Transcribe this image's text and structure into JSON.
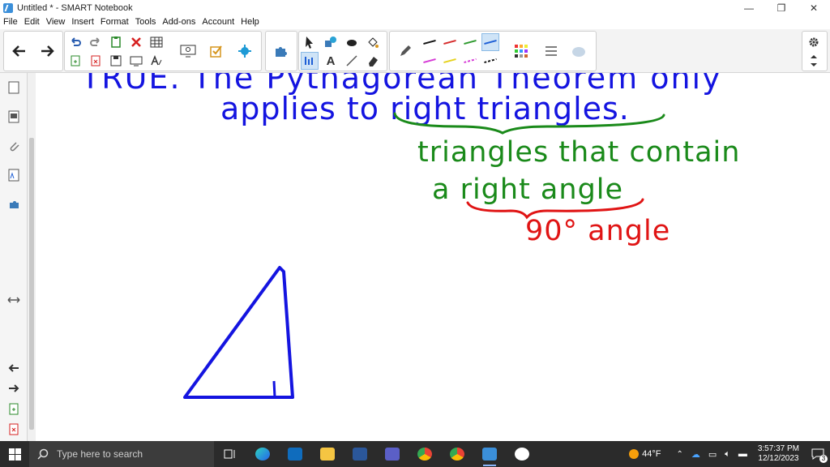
{
  "window": {
    "title": "Untitled * - SMART Notebook",
    "controls": {
      "minimize": "—",
      "restore": "❐",
      "close": "✕"
    }
  },
  "menu": [
    "File",
    "Edit",
    "View",
    "Insert",
    "Format",
    "Tools",
    "Add-ons",
    "Account",
    "Help"
  ],
  "toolbar": {
    "icons": {
      "back": "arrow-left-icon",
      "forward": "arrow-right-icon",
      "undo": "undo-icon",
      "redo": "redo-icon",
      "paste": "paste-icon",
      "delete": "delete-icon",
      "table": "table-icon",
      "screen": "screen-shade-icon",
      "check": "check-icon",
      "addon": "addon-icon",
      "select": "select-icon",
      "shapes": "shapes-icon",
      "eraser": "eraser-icon",
      "fill": "fill-icon",
      "text": "text-icon",
      "line": "line-icon",
      "pen": "pen-icon",
      "settings": "gear-icon",
      "properties": "properties-icon"
    },
    "pen_colors": [
      "#111111",
      "#d62b2b",
      "#2e9a2e",
      "#1e5fd6",
      "#d63ad6",
      "#e6d21e",
      "#111111"
    ],
    "accent": "#cfe4f7"
  },
  "canvas": {
    "ink_blue": "#1414e0",
    "ink_green": "#1a8a1a",
    "ink_red": "#e01414",
    "line1": "TRUE.  The Pythagorean Theorem only",
    "line2": "applies to right triangles.",
    "green1": "triangles that contain",
    "green2": "a right angle",
    "red1": "90° angle"
  },
  "taskbar": {
    "search_placeholder": "Type here to search",
    "weather": "44°F",
    "time": "3:57:37 PM",
    "date": "12/12/2023",
    "notifications": "3"
  }
}
